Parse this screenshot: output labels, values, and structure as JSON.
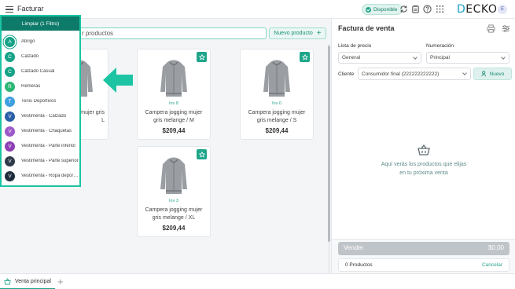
{
  "topbar": {
    "title": "Facturar",
    "status": "Disponible",
    "logo_prefix": "D",
    "logo_rest": "ECKO",
    "user_initial": "E"
  },
  "search": {
    "text": "r productos"
  },
  "new_product_label": "Nuevo producto",
  "partial_card": {
    "name_line1": "mujer gris",
    "name_line2": "L"
  },
  "products": [
    {
      "inv": "Inv 8",
      "name": "Campera jogging mujer gris melange / M",
      "price": "$209,44"
    },
    {
      "inv": "Inv 0",
      "name": "Campera jogging mujer gris melange / S",
      "price": "$209,44"
    },
    {
      "inv": "Inv 3",
      "name": "Campera jogging mujer gris melange / XL",
      "price": "$209,44"
    }
  ],
  "filter": {
    "header": "Limpiar (1 Filtro)",
    "items": [
      {
        "initial": "A",
        "label": "Abrigo",
        "color": "#16a387"
      },
      {
        "initial": "C",
        "label": "Calzado",
        "color": "#16a387"
      },
      {
        "initial": "C",
        "label": "Calzado Casual",
        "color": "#16a387"
      },
      {
        "initial": "R",
        "label": "Remeras",
        "color": "#2bb673"
      },
      {
        "initial": "T",
        "label": "Tenis Deportivos",
        "color": "#3f9fe0"
      },
      {
        "initial": "V",
        "label": "Vestimenta - Calzado",
        "color": "#2a5fa8"
      },
      {
        "initial": "V",
        "label": "Vestimenta - Chaquetas",
        "color": "#9b59c9"
      },
      {
        "initial": "V",
        "label": "Vestimenta - Parte inferior",
        "color": "#8e3fb6"
      },
      {
        "initial": "V",
        "label": "Vestimenta - Parte superior",
        "color": "#2f3b4a"
      },
      {
        "initial": "V",
        "label": "Vestimenta - Ropa deportiva",
        "color": "#1f2d3d"
      }
    ]
  },
  "invoice": {
    "title": "Factura de venta",
    "price_list_label": "Lista de precio",
    "price_list_value": "General",
    "numbering_label": "Numeración",
    "numbering_value": "Principal",
    "client_label": "Cliente",
    "client_value": "Consumidor final (222222222222)",
    "new_client_label": "Nuevo",
    "empty_line1": "Aquí verás los productos que elijas",
    "empty_line2": "en tu próxima venta",
    "sell_label": "Vender",
    "sell_total": "$0,00",
    "products_count": "0 Productos",
    "cancel_label": "Cancelar"
  },
  "tabs": {
    "active": "Venta principal",
    "add": "+"
  },
  "colors": {
    "accent": "#1fa68a",
    "highlight_border": "#1cc4a3",
    "filter_header": "#0e7a6a",
    "arrow": "#1cc4a3"
  }
}
